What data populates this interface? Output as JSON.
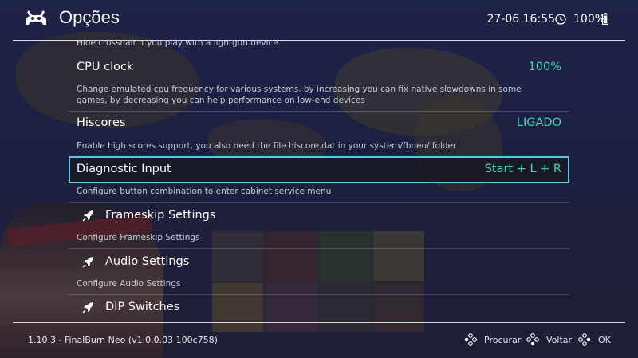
{
  "header": {
    "title": "Opções",
    "datetime": "27-06 16:55",
    "battery": "100%"
  },
  "menu": {
    "top_partial_sublabel": "Hide crosshair if you play with a lightgun device",
    "items": [
      {
        "label": "CPU clock",
        "value": "100%",
        "sublabel": "Change emulated cpu frequency for various systems, by increasing you can fix native slowdowns in some games, by decreasing you can help performance on low-end devices"
      },
      {
        "label": "Hiscores",
        "value": "LIGADO",
        "sublabel": "Enable high scores support, you also need the file hiscore.dat in your system/fbneo/ folder"
      },
      {
        "label": "Diagnostic Input",
        "value": "Start + L + R",
        "sublabel": "Configure button combination to enter cabinet service menu",
        "selected": true
      },
      {
        "label": "Frameskip Settings",
        "icon": "rocket-icon",
        "sublabel": "Configure Frameskip Settings"
      },
      {
        "label": "Audio Settings",
        "icon": "rocket-icon",
        "sublabel": "Configure Audio Settings"
      },
      {
        "label": "DIP Switches",
        "icon": "rocket-icon"
      }
    ]
  },
  "footer": {
    "core_info": "1.10.3 - FinalBurn Neo (v1.0.0.03 100c758)",
    "actions": [
      {
        "icon": "gamepad-buttons-icon",
        "label": "Procurar"
      },
      {
        "icon": "gamepad-buttons-icon",
        "label": "Voltar"
      },
      {
        "icon": "gamepad-buttons-icon",
        "label": "OK"
      }
    ]
  },
  "colors": {
    "value_accent": "#2ee0b0",
    "selection_border": "#5fc7df"
  }
}
